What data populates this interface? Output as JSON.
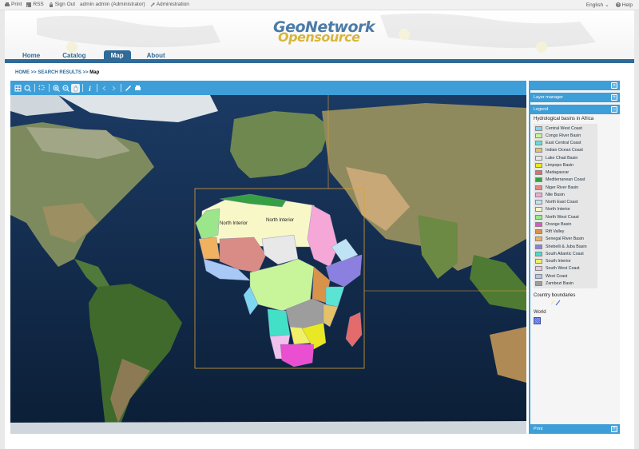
{
  "topbar": {
    "print": "Print",
    "rss": "RSS",
    "signout": "Sign Out",
    "user": "admin admin (Administrator)",
    "admin": "Administration",
    "language": "English",
    "help": "Help"
  },
  "logo": {
    "line1": "GeoNetwork",
    "line2": "Opensource"
  },
  "nav": {
    "home": "Home",
    "catalog": "Catalog",
    "map": "Map",
    "about": "About"
  },
  "breadcrumb": {
    "home": "HOME",
    "sep1": ">>",
    "results": "SEARCH RESULTS",
    "sep2": ">>",
    "current": "Map"
  },
  "map": {
    "labels": {
      "north_interior_1": "North Interior",
      "north_interior_2": "North Interior"
    }
  },
  "panel": {
    "layer_manager": "Layer manager",
    "legend": "Legend",
    "legend_title": "Hydrological basins in Africa",
    "basins": [
      {
        "name": "Central West Coast",
        "color": "#7fd6f2"
      },
      {
        "name": "Congo River Basin",
        "color": "#c8f59a"
      },
      {
        "name": "East Central Coast",
        "color": "#5be3d3"
      },
      {
        "name": "Indian Ocean Coast",
        "color": "#e3c26a"
      },
      {
        "name": "Lake Chad Basin",
        "color": "#e8e8e8"
      },
      {
        "name": "Limpopo Basin",
        "color": "#e8e824"
      },
      {
        "name": "Madagascar",
        "color": "#e46b6b"
      },
      {
        "name": "Mediterranean Coast",
        "color": "#35a043"
      },
      {
        "name": "Niger River Basin",
        "color": "#d98c86"
      },
      {
        "name": "Nile Basin",
        "color": "#f5a8d8"
      },
      {
        "name": "North East Coast",
        "color": "#bfe3f5"
      },
      {
        "name": "North Interior",
        "color": "#f7f7c8"
      },
      {
        "name": "North West Coast",
        "color": "#9be58b"
      },
      {
        "name": "Orange Basin",
        "color": "#e94fd0"
      },
      {
        "name": "Rift Valley",
        "color": "#d9924a"
      },
      {
        "name": "Senegal River Basin",
        "color": "#f0b160"
      },
      {
        "name": "Shebelli & Juba Basin",
        "color": "#8b7fe0"
      },
      {
        "name": "South Atlantic Coast",
        "color": "#43e0c8"
      },
      {
        "name": "South Interior",
        "color": "#f0f06a"
      },
      {
        "name": "South West Coast",
        "color": "#f1c1ee"
      },
      {
        "name": "West Coast",
        "color": "#a8c8f5"
      },
      {
        "name": "Zambezi Basin",
        "color": "#9d9d9d"
      }
    ],
    "country_boundaries": "Country boundaries",
    "world": "World",
    "print": "Print"
  },
  "colors": {
    "accent": "#3e9fd8",
    "nav": "#2f6a98"
  }
}
